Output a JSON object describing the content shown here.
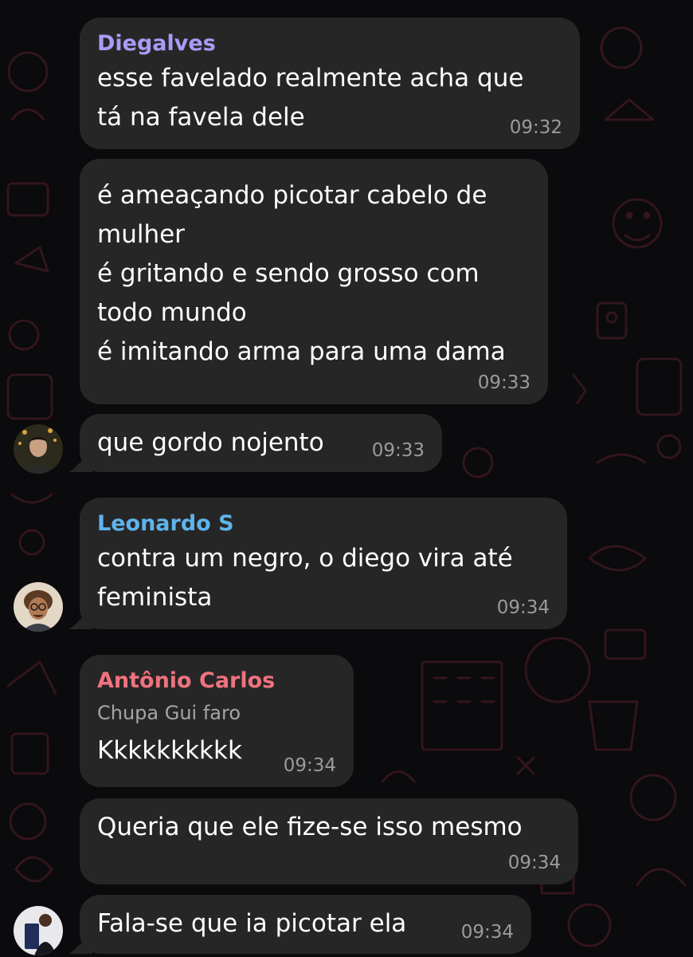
{
  "messages": [
    {
      "sender": "Diegalves",
      "sender_color": "#a99bf5",
      "text": "esse favelado realmente acha que\ntá na favela dele",
      "time": "09:32"
    },
    {
      "text": "é ameaçando picotar cabelo de\nmulher\né gritando e sendo grosso com\ntodo mundo\né imitando arma para uma dama",
      "time": "09:33"
    },
    {
      "text": "que gordo nojento",
      "time": "09:33"
    },
    {
      "sender": "Leonardo S",
      "sender_color": "#5fb3ec",
      "text": "contra um negro, o diego vira até\nfeminista",
      "time": "09:34"
    },
    {
      "sender": "Antônio Carlos",
      "sender_color": "#f0727e",
      "reply_preview": "Chupa Gui faro",
      "text": "Kkkkkkkkkk",
      "time": "09:34"
    },
    {
      "text": "Queria que ele fize-se isso mesmo",
      "time": "09:34"
    },
    {
      "text": "Fala-se que ia picotar ela",
      "time": "09:34"
    }
  ],
  "avatars": [
    {
      "name": "user-avatar-1"
    },
    {
      "name": "user-avatar-2"
    },
    {
      "name": "user-avatar-3"
    }
  ]
}
